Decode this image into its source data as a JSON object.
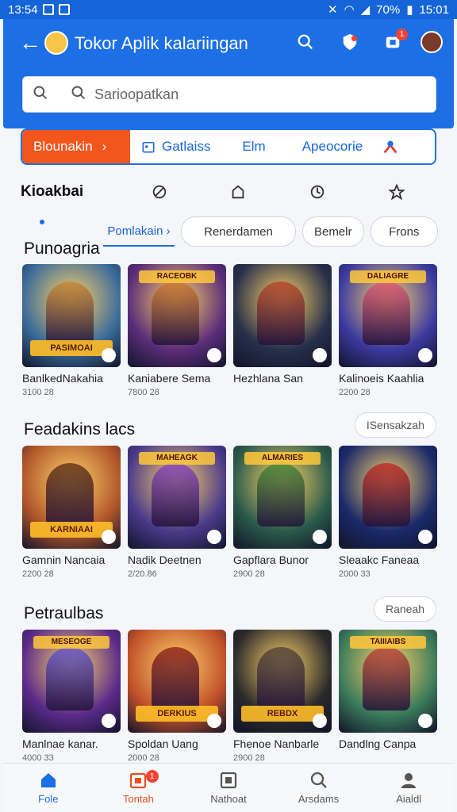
{
  "status": {
    "time_left": "13:54",
    "battery": "70%",
    "time_right": "15:01"
  },
  "header": {
    "title": "Tokor Aplik kalariingan"
  },
  "search": {
    "placeholder": "Sarioopatkan"
  },
  "category_bar": {
    "primary": "Blounakin",
    "items": [
      "Gatlaiss",
      "Elm",
      "Apeocorie"
    ]
  },
  "row2": {
    "label": "Kioakbai"
  },
  "tabs": [
    "Pomlakain",
    "Renerdamen",
    "Bemelr",
    "Frons"
  ],
  "sections": [
    {
      "title": "Punoagria",
      "more": "",
      "games": [
        {
          "name": "BanlkedNakahia",
          "sub": "3100 28",
          "banner": "PASIMOAI",
          "top": "",
          "bg": "#3a6b9a",
          "hero": "#c98a3a"
        },
        {
          "name": "Kaniabere Sema",
          "sub": "7800 28",
          "banner": "",
          "top": "RACEOBK",
          "bg": "#5b2d7a",
          "hero": "#d07a34"
        },
        {
          "name": "Hezhlana San",
          "sub": "",
          "banner": "",
          "top": "",
          "bg": "#27304a",
          "hero": "#b84a2c"
        },
        {
          "name": "Kalinoeis Kaahlia",
          "sub": "2200 28",
          "banner": "",
          "top": "DALIAGRE",
          "bg": "#3b3aa0",
          "hero": "#e05a7a"
        }
      ]
    },
    {
      "title": "Feadakins lacs",
      "more": "ISensakzah",
      "games": [
        {
          "name": "Gamnin Nancaia",
          "sub": "2200 28",
          "banner": "KARNIAAI",
          "top": "",
          "bg": "#b0552a",
          "hero": "#6a3a1a"
        },
        {
          "name": "Nadik Deetnen",
          "sub": "2/20.86",
          "banner": "",
          "top": "MAHEAGK",
          "bg": "#4a3a8a",
          "hero": "#8a4ac0"
        },
        {
          "name": "Gapflara Bunor",
          "sub": "2900 28",
          "banner": "",
          "top": "ALMARIES",
          "bg": "#2a5a4a",
          "hero": "#4a8a3a"
        },
        {
          "name": "Sleaakc Faneaa",
          "sub": "2000 33",
          "banner": "",
          "top": "",
          "bg": "#1a2a6a",
          "hero": "#c0302a"
        }
      ]
    },
    {
      "title": "Petraulbas",
      "more": "Raneah",
      "games": [
        {
          "name": "Manlnae kanar.",
          "sub": "4000 33",
          "banner": "",
          "top": "MESEOGE",
          "bg": "#5a2a8a",
          "hero": "#6a5ad0"
        },
        {
          "name": "Spoldan Uang",
          "sub": "2000 28",
          "banner": "DERKIUS",
          "top": "",
          "bg": "#c0502a",
          "hero": "#9a2a1a"
        },
        {
          "name": "Fhenoe Nanbarle",
          "sub": "2900 28",
          "banner": "REBDX",
          "top": "",
          "bg": "#2a2a2a",
          "hero": "#5a4a3a"
        },
        {
          "name": "Dandlng Canpa",
          "sub": "",
          "banner": "",
          "top": "TAIIIAIBS",
          "bg": "#3a7a5a",
          "hero": "#c04a3a"
        }
      ]
    }
  ],
  "bottom_nav": [
    {
      "label": "Fole",
      "icon": "home-icon"
    },
    {
      "label": "Tontah",
      "icon": "game-icon",
      "badge": "1"
    },
    {
      "label": "Nathoat",
      "icon": "apps-icon"
    },
    {
      "label": "Arsdams",
      "icon": "search-icon"
    },
    {
      "label": "Aialdl",
      "icon": "user-icon"
    }
  ],
  "colors": {
    "primary": "#1d6fe6",
    "accent": "#f2561d"
  }
}
